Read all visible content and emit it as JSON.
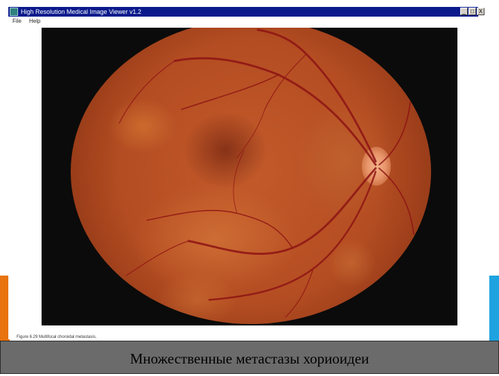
{
  "window": {
    "title": "High Resolution Medical Image Viewer v1.2",
    "buttons": {
      "minimize": "_",
      "maximize": "□",
      "close": "X"
    }
  },
  "menu": {
    "items": [
      "File",
      "Help"
    ]
  },
  "figure": {
    "caption": "Figure 6.29 Multifocal choroidal metastasis."
  },
  "slide": {
    "caption": "Множественные метастазы хориоидеи"
  },
  "colors": {
    "titlebar": "#0a1a8c",
    "accent_left": "#e8730f",
    "accent_right": "#1ea3e0",
    "banner": "#6b6b6b"
  }
}
